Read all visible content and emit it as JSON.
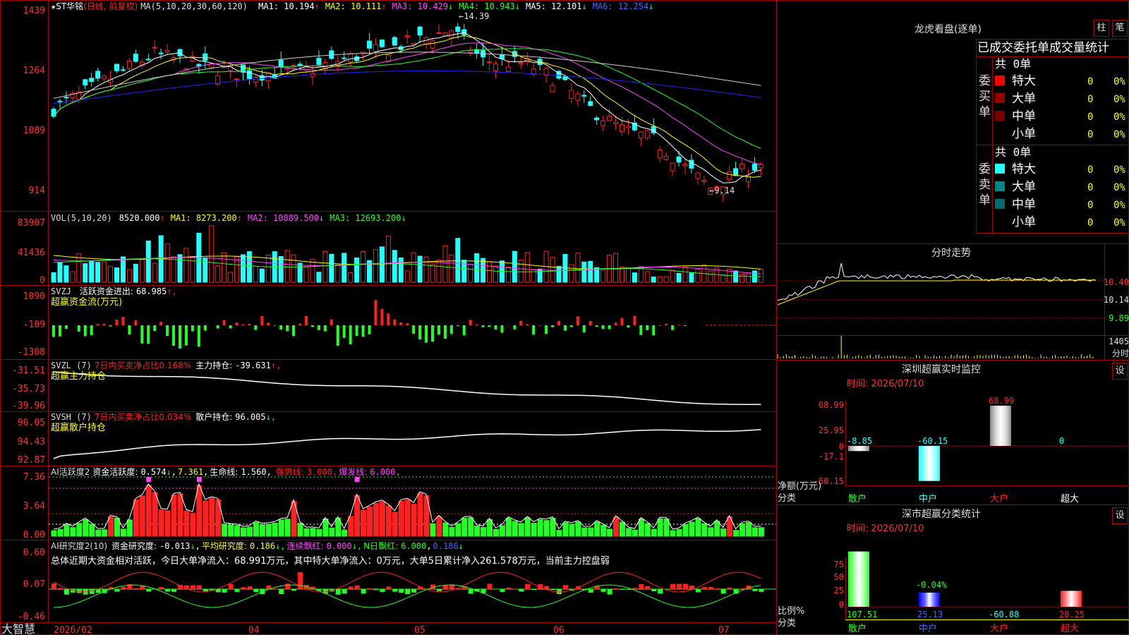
{
  "colors": {
    "up": "#ff2020",
    "down": "#22ffff",
    "grid": "#a00000",
    "vol_up": "#ff2020",
    "vol_down": "#22ffff",
    "ma5": "#ffffff",
    "ma10": "#ffff00",
    "ma20": "#ff44ff",
    "ma30": "#22ff22",
    "ma60": "#cccccc",
    "ma120": "#2222ff"
  },
  "header": {
    "star": "★",
    "stock": "ST华铭",
    "mode": "(日线, 前复权)",
    "ma_param": "MA(5,10,20,30,60,120)",
    "items": [
      {
        "k": "MA1:",
        "v": "10.194",
        "a": "↑",
        "c": "#ffffff"
      },
      {
        "k": "MA2:",
        "v": "10.111",
        "a": "↑",
        "c": "#ffff00"
      },
      {
        "k": "MA3:",
        "v": "10.429",
        "a": "↓",
        "c": "#ff44ff"
      },
      {
        "k": "MA4:",
        "v": "10.943",
        "a": "↓",
        "c": "#22ff22"
      },
      {
        "k": "MA5:",
        "v": "12.101",
        "a": "↓",
        "c": "#ffffff"
      },
      {
        "k": "MA6:",
        "v": "12.254",
        "a": "↓",
        "c": "#4466ff"
      }
    ]
  },
  "price_axis": [
    "1439",
    "1264",
    "1089",
    "914"
  ],
  "hi_label": "14.39",
  "lo_label": "9.14",
  "vol": {
    "title": "VOL(5,10,20)",
    "value": "8520.000",
    "arrow": "↑",
    "ma": [
      {
        "k": "MA1:",
        "v": "8273.200",
        "a": "↑",
        "c": "#ffff00"
      },
      {
        "k": "MA2:",
        "v": "10889.500",
        "a": "↓",
        "c": "#ff44ff"
      },
      {
        "k": "MA3:",
        "v": "12693.200",
        "a": "↓",
        "c": "#22ff22"
      }
    ],
    "axis": [
      "83907",
      "41436",
      "0"
    ]
  },
  "svzj": {
    "title": "SVZJ",
    "k": "活跃资金进出:",
    "v": "68.985",
    "a": "↑,",
    "sub": "超赢资金流(万元)",
    "axis": [
      "1090",
      "-109",
      "-1308"
    ]
  },
  "svzl": {
    "title": "SVZL (7)",
    "k1": "7日内买卖净占比0.168%",
    "k2": "主力持仓:",
    "v": "-39.631",
    "a": "↑,",
    "sub": "超赢主力持仓",
    "axis": [
      "-31.51",
      "-35.73",
      "-39.96"
    ]
  },
  "svsh": {
    "title": "SVSH (7)",
    "k1": "7日内买卖净占比0.034%",
    "k2": "散户持仓:",
    "v": "96.005",
    "a": "↓,",
    "sub": "超赢散户持仓",
    "axis": [
      "96.05",
      "94.43",
      "92.87"
    ]
  },
  "ai1": {
    "title": "AI活跃度2",
    "k": "资金活跃度:",
    "v": "0.574",
    "a": "↓",
    "v2": "7.361",
    "k3": "生命线:",
    "v3": "1.560",
    "k4": "强势线:",
    "v4": "3.000",
    "k5": "爆发线:",
    "v5": "6.000",
    "axis": [
      "7.36",
      "3.64",
      "0.00"
    ]
  },
  "ai2": {
    "title": "AI研究度2(10)",
    "k": "资金研究度:",
    "v": "-0.013",
    "a": "↓",
    "k2": "平均研究度:",
    "v2": "0.186",
    "k3": "连续飘红:",
    "v3": "0.000",
    "k4": "N日飘红:",
    "v4": "6.000",
    "v5": "0.186",
    "note": "总体近期大资金相对活跃，今日大单净流入：68.991万元，其中特大单净流入：0万元，大单5日累计净入261.578万元，当前主力控盘弱",
    "axis": [
      "0.60",
      "0.07",
      "-0.46"
    ]
  },
  "bottom": {
    "brand": "大智慧",
    "dates": [
      "2026/02",
      "04",
      "05",
      "06",
      "07"
    ]
  },
  "lhb": {
    "title": "龙虎看盘(逐单)",
    "tab1": "柱",
    "tab2": "笔",
    "head": "已成交委托单成交量统计",
    "buy": {
      "label": "委买单",
      "total": "共 0单",
      "rows": [
        {
          "n": "特大",
          "c": "#ff0000",
          "q": "0",
          "p": "0%"
        },
        {
          "n": "大单",
          "c": "#990000",
          "q": "0",
          "p": "0%"
        },
        {
          "n": "中单",
          "c": "#770000",
          "q": "0",
          "p": "0%"
        },
        {
          "n": "小单",
          "c": "",
          "q": "0",
          "p": "0%"
        }
      ]
    },
    "sell": {
      "label": "委卖单",
      "total": "共 0单",
      "rows": [
        {
          "n": "特大",
          "c": "#22ffff",
          "q": "0",
          "p": "0%"
        },
        {
          "n": "大单",
          "c": "#008888",
          "q": "0",
          "p": "0%"
        },
        {
          "n": "中单",
          "c": "#006b6b",
          "q": "0",
          "p": "0%"
        },
        {
          "n": "小单",
          "c": "",
          "q": "0",
          "p": "0%"
        }
      ]
    }
  },
  "fs": {
    "title": "分时走势",
    "axis": [
      "10.40",
      "10.14",
      "9.89"
    ],
    "vol_axis": [
      "1405",
      "分时"
    ]
  },
  "sz": {
    "title": "深圳超赢实时监控",
    "set": "设",
    "time": "时间: 2026/07/10",
    "axis": [
      "68.99",
      "25.95",
      "0",
      "-17.1",
      "-60.15"
    ],
    "ylabel": "净额(万元)",
    "xlabel": "分类",
    "cats": [
      "散户",
      "中户",
      "大户",
      "超大"
    ],
    "values": [
      -8.85,
      -60.15,
      68.99,
      0
    ],
    "labels": [
      "-8.85",
      "-60.15",
      "68.99",
      "0"
    ]
  },
  "sc": {
    "title": "深市超赢分类统计",
    "set": "设",
    "time": "时间: 2026/07/10",
    "axis": [
      "75",
      "50",
      "25",
      "0"
    ],
    "ylabel": "比例%",
    "xlabel": "分类",
    "cats": [
      "散户",
      "中户",
      "大户",
      "超大"
    ],
    "values": [
      107.51,
      25.13,
      -60.88,
      28.25
    ],
    "labels": [
      "107.51",
      "25.13",
      "-60.88",
      "28.25"
    ],
    "extra": "-0.04%"
  },
  "chart_data": {
    "type": "bar",
    "title": "深圳超赢实时监控",
    "categories": [
      "散户",
      "中户",
      "大户",
      "超大"
    ],
    "values": [
      -8.85,
      -60.15,
      68.99,
      0
    ],
    "ylabel": "净额(万元)",
    "xlabel": "分类",
    "ylim": [
      -60.15,
      68.99
    ]
  }
}
